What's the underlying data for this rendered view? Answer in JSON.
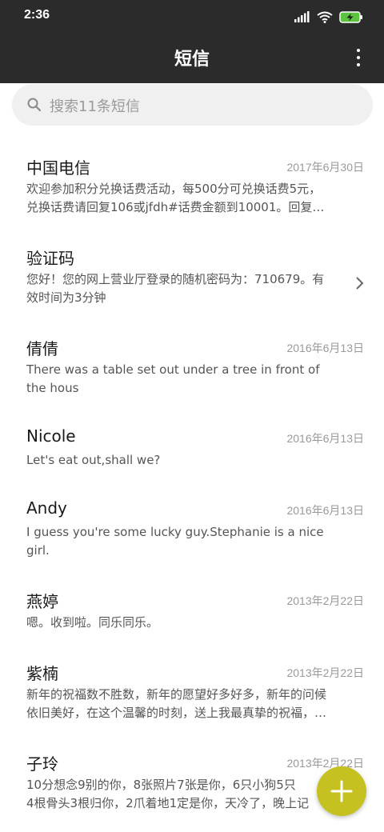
{
  "status_bar": {
    "time": "2:36",
    "icons": [
      "signal-icon",
      "wifi-icon",
      "battery-charging-icon"
    ]
  },
  "app_bar": {
    "title": "短信",
    "more_icon": "more-vertical-icon"
  },
  "search": {
    "placeholder": "搜索11条短信",
    "icon": "search-icon"
  },
  "messages": [
    {
      "name": "中国电信",
      "date": "2017年6月30日",
      "lines": [
        "欢迎参加积分兑换话费活动，每500分可兑换话费5元，",
        "兑换话费请回复106或jfdh#话费金额到10001。回复…"
      ]
    },
    {
      "name": "验证码",
      "date": "",
      "lines": [
        "您好！您的网上营业厅登录的随机密码为：710679。有",
        "效时间为3分钟"
      ],
      "chevron": true
    },
    {
      "name": "倩倩",
      "date": "2016年6月13日",
      "lines": [
        "There was a table set out under a tree in front of",
        "the hous"
      ]
    },
    {
      "name": "Nicole",
      "date": "2016年6月13日",
      "lines": [
        "Let's eat out,shall we?"
      ]
    },
    {
      "name": "Andy",
      "date": "2016年6月13日",
      "lines": [
        "I guess you're some lucky guy.Stephanie is a nice",
        "girl."
      ]
    },
    {
      "name": "燕婷",
      "date": "2013年2月22日",
      "lines": [
        "嗯。收到啦。同乐同乐。"
      ]
    },
    {
      "name": "紫楠",
      "date": "2013年2月22日",
      "lines": [
        "新年的祝福数不胜数，新年的愿望好多好多，新年的问候",
        "依旧美好，在这个温馨的时刻，送上我最真挚的祝福，…"
      ]
    },
    {
      "name": "子玲",
      "date": "2013年2月22日",
      "lines": [
        "10分想念9别的你，8张照片7张是你，6只小狗5只",
        "4根骨头3根归你，2爪着地1定是你，天冷了，晚上记"
      ]
    }
  ],
  "fab": {
    "icon": "plus-icon",
    "color": "#c4c121"
  },
  "colors": {
    "app_bar": "#2b2b2b",
    "search_bg": "#f0f0f0",
    "fab": "#c4c121"
  }
}
